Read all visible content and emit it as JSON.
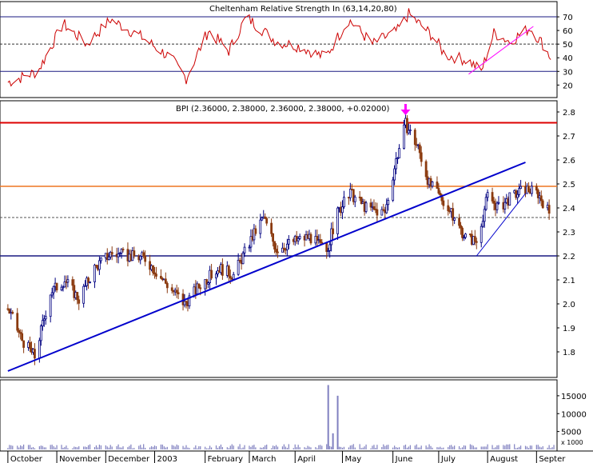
{
  "colors": {
    "background": "#ffffff",
    "rsi_line": "#cc0000",
    "rsi_trend": "#ff00ff",
    "candle_up": "#000080",
    "candle_down": "#8b3a0f",
    "resistance_line": "#dd0000",
    "support_orange": "#ee7722",
    "support_blue": "#1a1a80",
    "trendline": "#0000cc",
    "volume_bar": "#8080c0",
    "arrow": "#ff00ff"
  },
  "panels": {
    "rsi": {
      "title": "Cheltenham Relative Strength In (63,14,20,80)",
      "y_ticks": [
        20,
        30,
        40,
        50,
        60,
        70
      ],
      "ylim": [
        12,
        80
      ],
      "ref_lines": {
        "upper": 70,
        "mid": 50,
        "lower": 30
      }
    },
    "price": {
      "title": "BPI (2.36000, 2.38000, 2.36000, 2.38000, +0.02000)",
      "y_ticks": [
        "1.8",
        "1.9",
        "2.0",
        "2.1",
        "2.2",
        "2.3",
        "2.4",
        "2.5",
        "2.6",
        "2.7",
        "2.8"
      ],
      "ylim": [
        1.7,
        2.84
      ],
      "levels": {
        "resistance": 2.755,
        "orange": 2.49,
        "support": 2.2,
        "last": 2.36
      }
    },
    "volume": {
      "y_ticks": [
        "5000",
        "10000",
        "15000"
      ],
      "ylim": [
        0,
        19000
      ],
      "scale_label": "x 1000"
    }
  },
  "x_axis": {
    "months": [
      "October",
      "November",
      "December",
      "2003",
      "February",
      "March",
      "April",
      "May",
      "June",
      "July",
      "August",
      "Septer"
    ]
  },
  "chart_data": {
    "type": "candlestick",
    "title": "BPI (2.36000, 2.38000, 2.36000, 2.38000, +0.02000)",
    "price_path": [
      {
        "date": "2002-10-01",
        "close": 1.98
      },
      {
        "date": "2002-10-10",
        "close": 1.85
      },
      {
        "date": "2002-10-18",
        "close": 1.78
      },
      {
        "date": "2002-10-28",
        "close": 2.05
      },
      {
        "date": "2002-11-06",
        "close": 2.1
      },
      {
        "date": "2002-11-15",
        "close": 2.02
      },
      {
        "date": "2002-11-25",
        "close": 2.15
      },
      {
        "date": "2002-12-05",
        "close": 2.21
      },
      {
        "date": "2002-12-16",
        "close": 2.2
      },
      {
        "date": "2002-12-27",
        "close": 2.19
      },
      {
        "date": "2003-01-10",
        "close": 2.08
      },
      {
        "date": "2003-01-21",
        "close": 2.0
      },
      {
        "date": "2003-01-31",
        "close": 2.08
      },
      {
        "date": "2003-02-12",
        "close": 2.15
      },
      {
        "date": "2003-02-21",
        "close": 2.12
      },
      {
        "date": "2003-03-05",
        "close": 2.28
      },
      {
        "date": "2003-03-12",
        "close": 2.36
      },
      {
        "date": "2003-03-20",
        "close": 2.23
      },
      {
        "date": "2003-03-31",
        "close": 2.26
      },
      {
        "date": "2003-04-10",
        "close": 2.28
      },
      {
        "date": "2003-04-21",
        "close": 2.22
      },
      {
        "date": "2003-04-28",
        "close": 2.38
      },
      {
        "date": "2003-05-06",
        "close": 2.46
      },
      {
        "date": "2003-05-16",
        "close": 2.4
      },
      {
        "date": "2003-05-28",
        "close": 2.38
      },
      {
        "date": "2003-06-04",
        "close": 2.6
      },
      {
        "date": "2003-06-10",
        "close": 2.75
      },
      {
        "date": "2003-06-18",
        "close": 2.65
      },
      {
        "date": "2003-06-25",
        "close": 2.5
      },
      {
        "date": "2003-07-04",
        "close": 2.43
      },
      {
        "date": "2003-07-11",
        "close": 2.35
      },
      {
        "date": "2003-07-18",
        "close": 2.28
      },
      {
        "date": "2003-07-25",
        "close": 2.26
      },
      {
        "date": "2003-08-01",
        "close": 2.45
      },
      {
        "date": "2003-08-08",
        "close": 2.4
      },
      {
        "date": "2003-08-15",
        "close": 2.44
      },
      {
        "date": "2003-08-25",
        "close": 2.48
      },
      {
        "date": "2003-09-02",
        "close": 2.46
      },
      {
        "date": "2003-09-09",
        "close": 2.38
      }
    ],
    "rsi_path": [
      {
        "date": "2002-10-01",
        "value": 22
      },
      {
        "date": "2002-10-20",
        "value": 30
      },
      {
        "date": "2002-11-05",
        "value": 65
      },
      {
        "date": "2002-11-20",
        "value": 50
      },
      {
        "date": "2002-12-05",
        "value": 68
      },
      {
        "date": "2002-12-25",
        "value": 55
      },
      {
        "date": "2003-01-12",
        "value": 40
      },
      {
        "date": "2003-01-22",
        "value": 25
      },
      {
        "date": "2003-02-05",
        "value": 60
      },
      {
        "date": "2003-02-18",
        "value": 45
      },
      {
        "date": "2003-03-01",
        "value": 70
      },
      {
        "date": "2003-03-20",
        "value": 52
      },
      {
        "date": "2003-04-05",
        "value": 48
      },
      {
        "date": "2003-04-20",
        "value": 40
      },
      {
        "date": "2003-05-05",
        "value": 68
      },
      {
        "date": "2003-05-20",
        "value": 50
      },
      {
        "date": "2003-06-05",
        "value": 60
      },
      {
        "date": "2003-06-12",
        "value": 72
      },
      {
        "date": "2003-06-28",
        "value": 55
      },
      {
        "date": "2003-07-05",
        "value": 42
      },
      {
        "date": "2003-07-20",
        "value": 38
      },
      {
        "date": "2003-07-28",
        "value": 30
      },
      {
        "date": "2003-08-05",
        "value": 58
      },
      {
        "date": "2003-08-15",
        "value": 52
      },
      {
        "date": "2003-08-28",
        "value": 62
      },
      {
        "date": "2003-09-05",
        "value": 50
      },
      {
        "date": "2003-09-10",
        "value": 40
      }
    ],
    "volume_spikes": [
      {
        "date": "2003-04-22",
        "value": 18000
      },
      {
        "date": "2003-04-25",
        "value": 4500
      },
      {
        "date": "2003-04-28",
        "value": 15000
      }
    ],
    "trendlines": [
      {
        "from": {
          "date": "2002-10-01",
          "value": 1.72
        },
        "to": {
          "date": "2003-08-25",
          "value": 2.59
        }
      },
      {
        "from": {
          "date": "2003-07-25",
          "value": 2.2
        },
        "to": {
          "date": "2003-08-25",
          "value": 2.46
        }
      }
    ],
    "rsi_trendline": {
      "from": {
        "date": "2003-07-20",
        "value": 28
      },
      "to": {
        "date": "2003-08-30",
        "value": 63
      }
    },
    "arrow_marker": {
      "date": "2003-06-10",
      "value": 2.8
    },
    "ylim": [
      1.7,
      2.84
    ],
    "grid": false,
    "legend": "none"
  }
}
